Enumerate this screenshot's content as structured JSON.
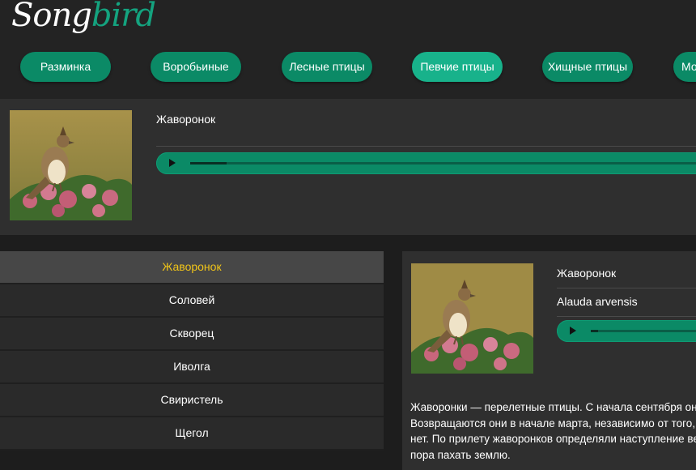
{
  "logo": {
    "part1": "Song",
    "part2": "bird"
  },
  "nav": [
    {
      "label": "Разминка"
    },
    {
      "label": "Воробьиные"
    },
    {
      "label": "Лесные птицы"
    },
    {
      "label": "Певчие птицы"
    },
    {
      "label": "Хищные птицы"
    },
    {
      "label": "Мо"
    }
  ],
  "nav_active_index": 3,
  "player": {
    "title": "Жаворонок",
    "progress": 0.07
  },
  "list": [
    {
      "label": "Жаворонок"
    },
    {
      "label": "Соловей"
    },
    {
      "label": "Скворец"
    },
    {
      "label": "Иволга"
    },
    {
      "label": "Свиристель"
    },
    {
      "label": "Щегол"
    }
  ],
  "list_active_index": 0,
  "detail": {
    "name": "Жаворонок",
    "latin": "Alauda arvensis",
    "progress": 0.06,
    "description": [
      "Жаворонки — перелетные птицы. С начала сентября они от",
      "Возвращаются они в начале марта, независимо от того, сош",
      "нет. По прилету жаворонков определяли наступление весн",
      "пора пахать землю."
    ]
  },
  "colors": {
    "accent": "#0b8a66",
    "accent_active": "#18b28b",
    "list_active_text": "#f0c419"
  }
}
